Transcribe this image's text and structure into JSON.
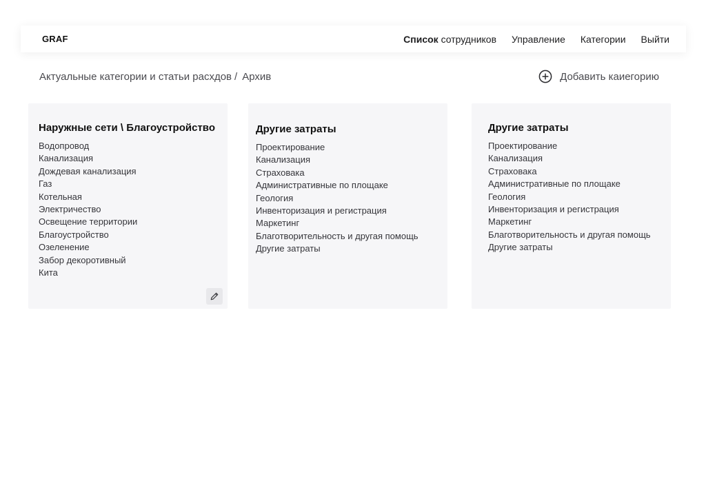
{
  "header": {
    "logo": "GRAF",
    "nav": {
      "employees_strong": "Список",
      "employees_rest": " сотрудников",
      "management": "Управление",
      "categories": "Категории",
      "logout": "Выйти"
    }
  },
  "breadcrumb": {
    "current": "Актуальные категории и статьи расхдов",
    "separator": "/",
    "archive": "Архив"
  },
  "add_category": {
    "label": "Добавить каиегорию",
    "icon": "plus-circle-icon"
  },
  "cards": [
    {
      "title": "Наружные сети \\ Благоустройство",
      "items": [
        "Водопровод",
        "Канализация",
        "Дождевая канализация",
        "Газ",
        "Котельная",
        "Электричество",
        "Освещение территории",
        "Благоустройство",
        "Озеленение",
        "Забор декоротивный",
        "Кита"
      ],
      "edit_icon": "pencil-icon"
    },
    {
      "title": "Другие затраты",
      "items": [
        "Проектирование",
        "Канализация",
        "Страховака",
        "Административные по площаке",
        "Геология",
        "Инвенторизация и регистрация",
        "Маркетинг",
        "Благотворительность и другая помощь",
        "Другие затраты"
      ]
    },
    {
      "title": "Другие затраты",
      "items": [
        "Проектирование",
        "Канализация",
        "Страховака",
        "Административные по площаке",
        "Геология",
        "Инвенторизация и регистрация",
        "Маркетинг",
        "Благотворительность и другая помощь",
        "Другие затраты"
      ]
    }
  ]
}
